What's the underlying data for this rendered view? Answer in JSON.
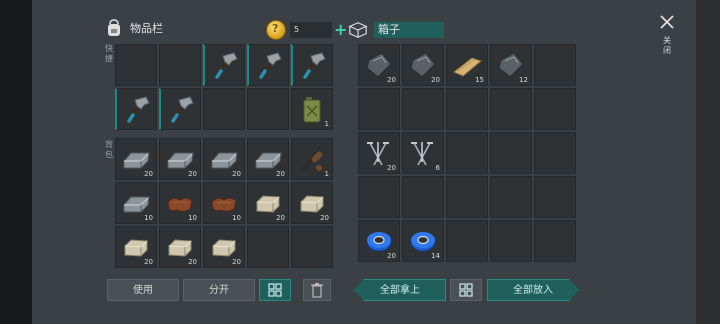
{
  "inventory": {
    "title": "物品栏",
    "gold": "5",
    "gold_add": "+",
    "quick_label": "快捷",
    "backpack_label": "背包",
    "quick_slots": [
      {
        "item": "",
        "qty": ""
      },
      {
        "item": "",
        "qty": ""
      },
      {
        "item": "hammer-icon",
        "qty": "",
        "eq": true
      },
      {
        "item": "hammer-icon",
        "qty": "",
        "eq": true
      },
      {
        "item": "hammer-icon",
        "qty": "",
        "eq": true
      },
      {
        "item": "hammer-icon",
        "qty": "",
        "eq": true
      },
      {
        "item": "hammer-icon",
        "qty": "",
        "eq": true
      },
      {
        "item": "",
        "qty": ""
      },
      {
        "item": "",
        "qty": ""
      },
      {
        "item": "jerrycan-icon",
        "qty": "1"
      }
    ],
    "backpack_slots": [
      {
        "item": "metal-ingot-icon",
        "qty": "20"
      },
      {
        "item": "metal-ingot-icon",
        "qty": "20"
      },
      {
        "item": "metal-ingot-icon",
        "qty": "20"
      },
      {
        "item": "metal-ingot-icon",
        "qty": "20"
      },
      {
        "item": "backpack-tool-icon",
        "qty": "1"
      },
      {
        "item": "metal-ingot-icon",
        "qty": "10"
      },
      {
        "item": "leather-icon",
        "qty": "10"
      },
      {
        "item": "leather-icon",
        "qty": "10"
      },
      {
        "item": "stone-brick-icon",
        "qty": "20"
      },
      {
        "item": "stone-brick-icon",
        "qty": "20"
      },
      {
        "item": "stone-brick-icon",
        "qty": "20"
      },
      {
        "item": "stone-brick-icon",
        "qty": "20"
      },
      {
        "item": "stone-brick-icon",
        "qty": "20"
      },
      {
        "item": "",
        "qty": ""
      },
      {
        "item": "",
        "qty": ""
      }
    ],
    "use_label": "使用",
    "split_label": "分开"
  },
  "box": {
    "title": "箱子",
    "slots": [
      {
        "item": "iron-plate-icon",
        "qty": "20"
      },
      {
        "item": "iron-plate-icon",
        "qty": "20"
      },
      {
        "item": "plank-icon",
        "qty": "15"
      },
      {
        "item": "iron-plate-icon",
        "qty": "12"
      },
      {
        "item": "",
        "qty": ""
      },
      {
        "item": "",
        "qty": ""
      },
      {
        "item": "",
        "qty": ""
      },
      {
        "item": "",
        "qty": ""
      },
      {
        "item": "",
        "qty": ""
      },
      {
        "item": "",
        "qty": ""
      },
      {
        "item": "nails-icon",
        "qty": "20"
      },
      {
        "item": "nails-icon",
        "qty": "6"
      },
      {
        "item": "",
        "qty": ""
      },
      {
        "item": "",
        "qty": ""
      },
      {
        "item": "",
        "qty": ""
      },
      {
        "item": "",
        "qty": ""
      },
      {
        "item": "",
        "qty": ""
      },
      {
        "item": "",
        "qty": ""
      },
      {
        "item": "",
        "qty": ""
      },
      {
        "item": "",
        "qty": ""
      },
      {
        "item": "tape-icon",
        "qty": "20"
      },
      {
        "item": "tape-icon",
        "qty": "14"
      },
      {
        "item": "",
        "qty": ""
      },
      {
        "item": "",
        "qty": ""
      },
      {
        "item": "",
        "qty": ""
      }
    ],
    "take_all_label": "全部拿上",
    "put_all_label": "全部放入"
  },
  "close_label": "关闭",
  "colors": {
    "accent": "#1f5f5c",
    "panel": "#3b4045",
    "slot": "#2e3235"
  }
}
